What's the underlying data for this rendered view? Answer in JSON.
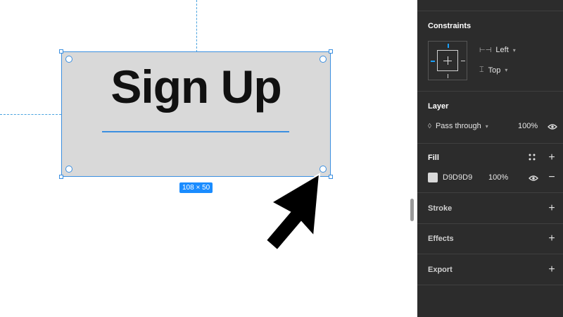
{
  "canvas": {
    "frame_text": "Sign Up",
    "size_label": "108 × 50"
  },
  "panel": {
    "constraints": {
      "title": "Constraints",
      "horizontal": "Left",
      "vertical": "Top"
    },
    "layer": {
      "title": "Layer",
      "blend_mode": "Pass through",
      "opacity": "100%"
    },
    "fill": {
      "title": "Fill",
      "hex": "D9D9D9",
      "opacity": "100%"
    },
    "stroke": {
      "title": "Stroke"
    },
    "effects": {
      "title": "Effects"
    },
    "export": {
      "title": "Export"
    }
  },
  "colors": {
    "selection_blue": "#3b8fe0",
    "panel_bg": "#2c2c2c",
    "fill_color": "#d9d9d9"
  }
}
